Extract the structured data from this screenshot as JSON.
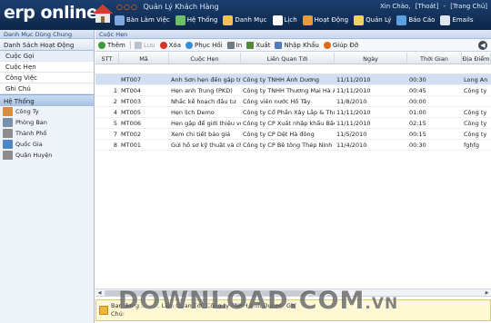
{
  "header": {
    "logo_erp": "erp",
    "logo_online": "online",
    "app_title": "Quản Lý Khách Hàng",
    "title_dots": "○○○",
    "greeting": "Xin Chào,",
    "logout": "[Thoát]",
    "home": "[Trang Chủ]",
    "nav": [
      {
        "label": "Bàn Làm Việc",
        "icon": "desk-icon",
        "color": "#7fa8e0"
      },
      {
        "label": "Hệ Thống",
        "icon": "system-icon",
        "color": "#6fbf6a"
      },
      {
        "label": "Danh Mục",
        "icon": "folder-icon",
        "color": "#f2c14e"
      },
      {
        "label": "Lịch",
        "icon": "calendar-icon",
        "color": "#ffffff"
      },
      {
        "label": "Hoạt Động",
        "icon": "activity-icon",
        "color": "#e89a3c"
      },
      {
        "label": "Quản Lý",
        "icon": "manage-icon",
        "color": "#f2d35a"
      },
      {
        "label": "Báo Cáo",
        "icon": "report-icon",
        "color": "#5ea0e0"
      },
      {
        "label": "Emails",
        "icon": "email-icon",
        "color": "#dfe6ef"
      }
    ]
  },
  "sidebar": {
    "title": "Danh Mục Dùng Chung",
    "section_activities": "Danh Sách Hoạt Động",
    "items": [
      {
        "label": "Cuộc Gọi"
      },
      {
        "label": "Cuộc Hẹn"
      },
      {
        "label": "Công Việc"
      },
      {
        "label": "Ghi Chú"
      }
    ],
    "section_system": "Hệ Thống",
    "system_items": [
      {
        "label": "Công Ty",
        "icon": "company-icon",
        "color": "#d98c3a"
      },
      {
        "label": "Phòng Ban",
        "icon": "department-icon",
        "color": "#7a8fa8"
      },
      {
        "label": "Thành Phố",
        "icon": "city-icon",
        "color": "#8c8c8c"
      },
      {
        "label": "Quốc Gia",
        "icon": "country-icon",
        "color": "#4d86c6"
      },
      {
        "label": "Quận Huyện",
        "icon": "district-icon",
        "color": "#8c8c8c"
      }
    ]
  },
  "main": {
    "breadcrumb": "Cuộc Hẹn",
    "toolbar": {
      "add": "Thêm",
      "save": "Lưu",
      "delete": "Xóa",
      "restore": "Phục Hồi",
      "print": "In",
      "export": "Xuất",
      "import": "Nhập Khẩu",
      "help": "Giúp Đỡ"
    },
    "columns": [
      "STT",
      "Mã",
      "Cuộc Hẹn",
      "Liên Quan Tới",
      "Ngày",
      "Thời Gian",
      "Địa Điểm"
    ],
    "rows": [
      {
        "stt": "",
        "ma": "MT007",
        "cuoc_hen": "Anh Sơn hẹn đến gặp trực tiếp",
        "lien_quan": "Công ty TNHH Ánh Dương",
        "ngay": "11/11/2010",
        "thoi_gian": "00:30",
        "dia_diem": "Long An"
      },
      {
        "stt": "1",
        "ma": "MT004",
        "cuoc_hen": "Hẹn anh Trung (PKD)",
        "lien_quan": "Công ty TNHH Thương Mại Hà Anh",
        "ngay": "11/11/2010",
        "thoi_gian": "00:45",
        "dia_diem": "Công ty"
      },
      {
        "stt": "2",
        "ma": "MT003",
        "cuoc_hen": "Nhắc kế hoạch đầu tư",
        "lien_quan": "Công viên nước Hồ Tây",
        "ngay": "11/8/2010",
        "thoi_gian": "00:00",
        "dia_diem": ""
      },
      {
        "stt": "4",
        "ma": "MT005",
        "cuoc_hen": "Hẹn lịch Demo",
        "lien_quan": "Công ty Cổ Phần Xây Lắp & Thương mại",
        "ngay": "11/11/2010",
        "thoi_gian": "01:00",
        "dia_diem": "Công ty"
      },
      {
        "stt": "5",
        "ma": "MT006",
        "cuoc_hen": "Hẹn gặp để giới thiệu về sản phẩm",
        "lien_quan": "Công ty CP Xuất nhập khẩu Bắc Giang",
        "ngay": "11/11/2010",
        "thoi_gian": "02:15",
        "dia_diem": "Công ty"
      },
      {
        "stt": "7",
        "ma": "MT002",
        "cuoc_hen": "Xem chi tiết báo giá",
        "lien_quan": "Công ty CP Dệt Hà đông",
        "ngay": "11/5/2010",
        "thoi_gian": "00:15",
        "dia_diem": "Công ty"
      },
      {
        "stt": "8",
        "ma": "MT001",
        "cuoc_hen": "Gửi hồ sơ kỹ thuật và chào giá",
        "lien_quan": "Công ty CP Bê tông Thép Ninh Bình",
        "ngay": "11/4/2010",
        "thoi_gian": "00:30",
        "dia_diem": "fghfg"
      }
    ],
    "status_text_1": "Bạn đang ...                                          ...... Liên Quan Tới: Công ty TNHH Ánh Dương, Ghi",
    "status_text_2": "Chú:"
  },
  "watermark": {
    "main": "DOWNLOAD.COM",
    "suffix": ".VN"
  }
}
